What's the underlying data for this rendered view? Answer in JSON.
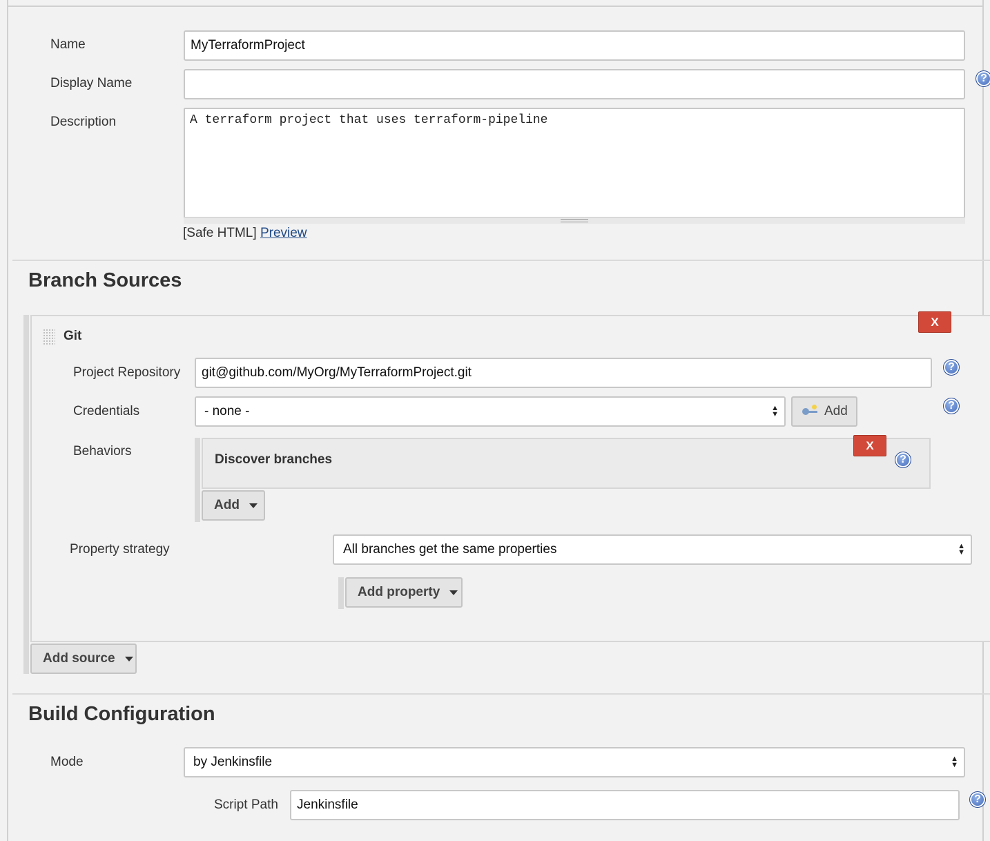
{
  "general": {
    "name_label": "Name",
    "name_value": "MyTerraformProject",
    "display_name_label": "Display Name",
    "display_name_value": "",
    "description_label": "Description",
    "description_value": "A terraform project that uses terraform-pipeline",
    "safe_html_text": "[Safe HTML]",
    "preview_link": "Preview"
  },
  "branch_sources": {
    "title": "Branch Sources",
    "git": {
      "title": "Git",
      "delete_label": "X",
      "project_repository_label": "Project Repository",
      "project_repository_value": "git@github.com/MyOrg/MyTerraformProject.git",
      "credentials_label": "Credentials",
      "credentials_value": "- none -",
      "credentials_add_label": "Add",
      "behaviors_label": "Behaviors",
      "behavior": {
        "title": "Discover branches",
        "delete_label": "X"
      },
      "behaviors_add_label": "Add",
      "property_strategy_label": "Property strategy",
      "property_strategy_value": "All branches get the same properties",
      "add_property_label": "Add property"
    },
    "add_source_label": "Add source"
  },
  "build_configuration": {
    "title": "Build Configuration",
    "mode_label": "Mode",
    "mode_value": "by Jenkinsfile",
    "script_path_label": "Script Path",
    "script_path_value": "Jenkinsfile"
  },
  "icons": {
    "help": "question-mark-help-icon",
    "drag": "drag-handle-icon",
    "key": "key-icon",
    "select": "up-down-arrows-icon",
    "caret": "caret-down-icon"
  },
  "colors": {
    "delete_button": "#d24939",
    "link": "#204a87",
    "help_icon": "#3f66b8"
  }
}
